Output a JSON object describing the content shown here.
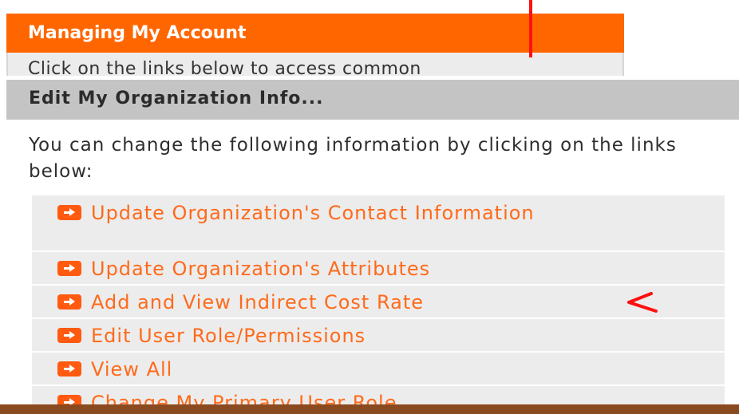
{
  "background_panel": {
    "title": "Managing My Account",
    "intro": "Click on the links below to access common"
  },
  "popup": {
    "title": "Edit My Organization Info...",
    "description": "You can change the following information by clicking on the links below:",
    "links": [
      {
        "label": "Update Organization's Contact Information",
        "icon": "arrow-right-icon"
      },
      {
        "label": "Update Organization's Attributes",
        "icon": "arrow-right-icon"
      },
      {
        "label": "Add and View Indirect Cost Rate",
        "icon": "arrow-right-icon"
      },
      {
        "label": "Edit User Role/Permissions",
        "icon": "arrow-right-icon"
      },
      {
        "label": "View All",
        "icon": "arrow-right-icon"
      },
      {
        "label": "Change My Primary User Role",
        "icon": "arrow-right-icon"
      }
    ]
  },
  "annotations": {
    "marker_text": "<",
    "marker_color": "#ff1010"
  },
  "colors": {
    "accent": "#ff6600",
    "link": "#ff6a1a",
    "header_gray": "#c4c4c4",
    "row_gray": "#ececec",
    "bottom_bar": "#8a4a1f"
  }
}
